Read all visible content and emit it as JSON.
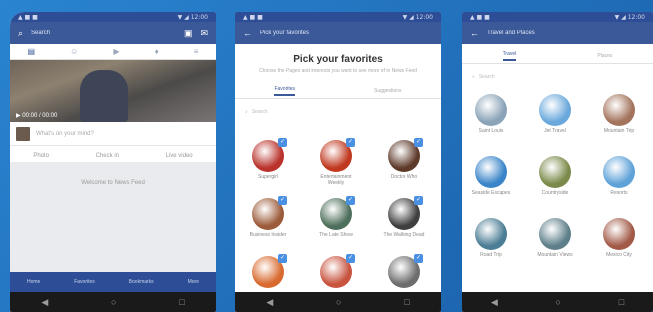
{
  "phone1": {
    "status": {
      "left": "▲ ■ ■",
      "right": "▼ ◢ 12:00"
    },
    "search_placeholder": "Search",
    "cover_caption": "▶ 00:00 / 00:00",
    "status_placeholder": "What's on your mind?",
    "actions": [
      "Photo",
      "Check in",
      "Live video"
    ],
    "feed_message": "Welcome to News Feed",
    "bottom_tabs": [
      "Home",
      "Favorites",
      "Bookmarks",
      "More"
    ]
  },
  "phone2": {
    "topbar_title": "Pick your favorites",
    "title": "Pick your favorites",
    "subtitle": "Choose the Pages and interests you want to see more of in News Feed",
    "tabs": [
      "Favorites",
      "Suggestions"
    ],
    "search_placeholder": "Search",
    "items": [
      {
        "label": "Supergirl",
        "color": "#b9322b"
      },
      {
        "label": "Entertainment Weekly",
        "color": "#c0381f"
      },
      {
        "label": "Doctor Who",
        "color": "#5e3a2a"
      },
      {
        "label": "Business Insider",
        "color": "#9c5b3a"
      },
      {
        "label": "The Late Show",
        "color": "#4e6f5b"
      },
      {
        "label": "The Walking Dead",
        "color": "#3f3f3f"
      },
      {
        "label": "",
        "color": "#d86a2f"
      },
      {
        "label": "",
        "color": "#c8533e"
      },
      {
        "label": "",
        "color": "#6d6d6d"
      }
    ]
  },
  "phone3": {
    "topbar_title": "Travel and Places",
    "tabs": [
      "Travel",
      "Places"
    ],
    "search_placeholder": "Search",
    "items": [
      {
        "label": "Saint Louis",
        "color": "#8aa3b8"
      },
      {
        "label": "Jet Travel",
        "color": "#6aa8dc"
      },
      {
        "label": "Mountain Trip",
        "color": "#a3735b"
      },
      {
        "label": "Seaside Escapes",
        "color": "#3a85c9"
      },
      {
        "label": "Countryside",
        "color": "#7b8a4a"
      },
      {
        "label": "Resorts",
        "color": "#5fa2d8"
      },
      {
        "label": "Road Trip",
        "color": "#4b7d94"
      },
      {
        "label": "Mountain Views",
        "color": "#5e7f8a"
      },
      {
        "label": "Mexico City",
        "color": "#a25a47"
      }
    ]
  }
}
